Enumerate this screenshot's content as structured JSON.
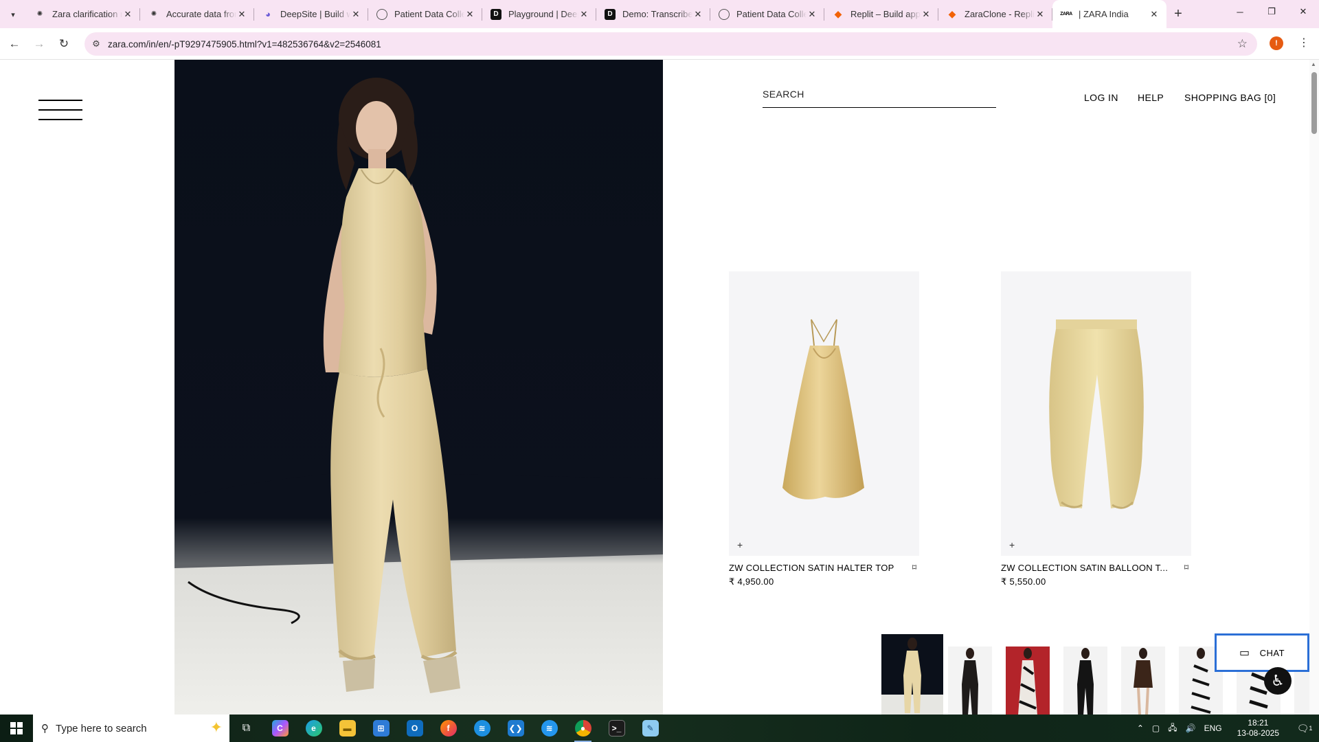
{
  "browser": {
    "tabs": [
      {
        "title": "Zara clarification n",
        "favicon": "openai-icon",
        "active": false
      },
      {
        "title": "Accurate data from",
        "favicon": "openai-icon",
        "active": false
      },
      {
        "title": "DeepSite | Build w",
        "favicon": "deepsite-icon",
        "active": false
      },
      {
        "title": "Patient Data Colle",
        "favicon": "globe-icon",
        "active": false
      },
      {
        "title": "Playground | Deep",
        "favicon": "deepgram-icon",
        "active": false
      },
      {
        "title": "Demo: Transcribe",
        "favicon": "deepgram-icon",
        "active": false
      },
      {
        "title": "Patient Data Colle",
        "favicon": "globe-icon",
        "active": false
      },
      {
        "title": "Replit – Build app",
        "favicon": "replit-icon",
        "active": false
      },
      {
        "title": "ZaraClone - Replit",
        "favicon": "replit-icon",
        "active": false
      },
      {
        "title": "| ZARA India",
        "favicon": "zara-icon",
        "active": true
      }
    ],
    "url": "zara.com/in/en/-pT9297475905.html?v1=482536764&v2=2546081",
    "profile_initial": "!",
    "colors": {
      "tabbar_bg": "#f8e4f3",
      "omnibox_bg": "#f8e4f3",
      "profile": "#e65b12"
    }
  },
  "header": {
    "search_label": "SEARCH",
    "login": "LOG IN",
    "help": "HELP",
    "bag": "SHOPPING BAG [0]"
  },
  "products": [
    {
      "name": "ZW COLLECTION SATIN HALTER TOP",
      "price": "₹ 4,950.00"
    },
    {
      "name": "ZW COLLECTION SATIN BALLOON T...",
      "price": "₹ 5,550.00"
    }
  ],
  "related_looks": [
    {
      "label": "look-1",
      "active": true
    },
    {
      "label": "look-2",
      "active": false
    },
    {
      "label": "look-3",
      "active": false
    },
    {
      "label": "look-4",
      "active": false
    },
    {
      "label": "look-5",
      "active": false
    },
    {
      "label": "look-6",
      "active": false
    },
    {
      "label": "look-7",
      "active": false
    }
  ],
  "chat": {
    "label": "CHAT",
    "border_color": "#2b6fd6"
  },
  "taskbar": {
    "search_placeholder": "Type here to search",
    "language": "ENG",
    "time": "18:21",
    "date": "13-08-2025",
    "notification_count": "1"
  }
}
